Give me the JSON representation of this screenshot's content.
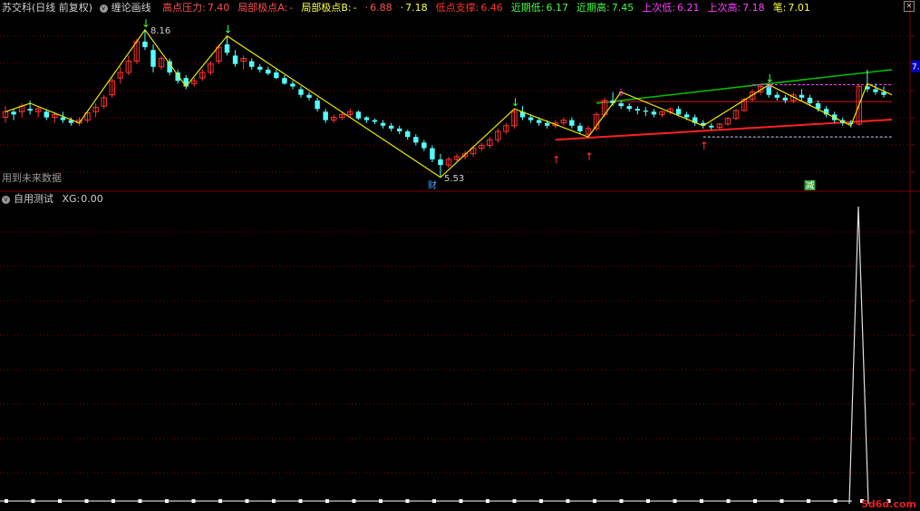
{
  "header": {
    "stock_name": "苏交科(日线 前复权)",
    "indicator_name": "缠论画线",
    "items": [
      {
        "label": "高点压力:",
        "value": "7.40",
        "color": "#ff5050"
      },
      {
        "label": "局部极点A:",
        "value": "-",
        "color": "#ff5050"
      },
      {
        "label": "局部极点B:",
        "value": "-",
        "color": "#ffff40"
      },
      {
        "label": "·",
        "value": "6.88",
        "color": "#ff5050"
      },
      {
        "label": "·",
        "value": "7.18",
        "color": "#ffff40"
      },
      {
        "label": "低点支撑:",
        "value": "6.46",
        "color": "#ff3030"
      },
      {
        "label": "近期低:",
        "value": "6.17",
        "color": "#40ff40"
      },
      {
        "label": "近期高:",
        "value": "7.45",
        "color": "#40ff40"
      },
      {
        "label": "上次低:",
        "value": "6.21",
        "color": "#ff40ff"
      },
      {
        "label": "上次高:",
        "value": "7.18",
        "color": "#ff40ff"
      },
      {
        "label": "笔:",
        "value": "7.01",
        "color": "#ffff40"
      }
    ]
  },
  "chart_annotations": {
    "high_label": "8.16",
    "low_label": "5.53",
    "future_data_note": "用到未来数据",
    "price_tag": "7.5",
    "marker_cai": "财",
    "marker_jian": "减"
  },
  "sub_panel": {
    "title": "自用测试",
    "xg_label": "XG:",
    "xg_value": "0.00"
  },
  "watermark": "5d6d.com",
  "colors": {
    "up": "#ff3232",
    "down": "#54ffff",
    "bi_line": "#e8e800",
    "upper_trend": "#00c000",
    "lower_trend": "#ff2020",
    "grid": "#800000",
    "pivot": "#ff40ff"
  },
  "chart_data": {
    "type": "candlestick",
    "ylim": [
      5.3,
      8.4
    ],
    "candles": [
      [
        6.6,
        6.8,
        6.5,
        6.7
      ],
      [
        6.7,
        6.75,
        6.55,
        6.65
      ],
      [
        6.7,
        6.85,
        6.6,
        6.8
      ],
      [
        6.75,
        6.9,
        6.65,
        6.72
      ],
      [
        6.7,
        6.8,
        6.6,
        6.75
      ],
      [
        6.7,
        6.75,
        6.55,
        6.6
      ],
      [
        6.6,
        6.7,
        6.5,
        6.65
      ],
      [
        6.6,
        6.7,
        6.5,
        6.55
      ],
      [
        6.55,
        6.6,
        6.45,
        6.5
      ],
      [
        6.5,
        6.6,
        6.45,
        6.55
      ],
      [
        6.55,
        6.7,
        6.5,
        6.68
      ],
      [
        6.7,
        6.85,
        6.6,
        6.78
      ],
      [
        6.8,
        7.0,
        6.75,
        6.95
      ],
      [
        7.0,
        7.3,
        6.95,
        7.25
      ],
      [
        7.3,
        7.5,
        7.2,
        7.4
      ],
      [
        7.4,
        7.7,
        7.35,
        7.6
      ],
      [
        7.6,
        8.0,
        7.55,
        7.95
      ],
      [
        7.95,
        8.16,
        7.8,
        7.85
      ],
      [
        7.8,
        7.9,
        7.4,
        7.5
      ],
      [
        7.5,
        7.7,
        7.45,
        7.65
      ],
      [
        7.6,
        7.65,
        7.35,
        7.4
      ],
      [
        7.4,
        7.45,
        7.2,
        7.25
      ],
      [
        7.3,
        7.35,
        7.1,
        7.15
      ],
      [
        7.2,
        7.3,
        7.15,
        7.25
      ],
      [
        7.3,
        7.45,
        7.25,
        7.4
      ],
      [
        7.4,
        7.6,
        7.35,
        7.55
      ],
      [
        7.6,
        7.9,
        7.55,
        7.85
      ],
      [
        7.9,
        8.05,
        7.7,
        7.75
      ],
      [
        7.7,
        7.8,
        7.5,
        7.55
      ],
      [
        7.6,
        7.7,
        7.45,
        7.65
      ],
      [
        7.6,
        7.65,
        7.45,
        7.5
      ],
      [
        7.5,
        7.55,
        7.4,
        7.45
      ],
      [
        7.45,
        7.5,
        7.35,
        7.38
      ],
      [
        7.4,
        7.45,
        7.28,
        7.3
      ],
      [
        7.3,
        7.35,
        7.18,
        7.2
      ],
      [
        7.2,
        7.25,
        7.1,
        7.15
      ],
      [
        7.1,
        7.15,
        6.95,
        7.0
      ],
      [
        7.0,
        7.05,
        6.9,
        6.95
      ],
      [
        6.9,
        6.95,
        6.7,
        6.75
      ],
      [
        6.7,
        6.75,
        6.5,
        6.55
      ],
      [
        6.55,
        6.65,
        6.5,
        6.6
      ],
      [
        6.6,
        6.7,
        6.55,
        6.65
      ],
      [
        6.65,
        6.75,
        6.6,
        6.7
      ],
      [
        6.7,
        6.72,
        6.55,
        6.58
      ],
      [
        6.6,
        6.62,
        6.5,
        6.55
      ],
      [
        6.55,
        6.58,
        6.48,
        6.52
      ],
      [
        6.5,
        6.55,
        6.4,
        6.45
      ],
      [
        6.45,
        6.5,
        6.35,
        6.4
      ],
      [
        6.4,
        6.45,
        6.3,
        6.35
      ],
      [
        6.35,
        6.38,
        6.2,
        6.25
      ],
      [
        6.25,
        6.3,
        6.1,
        6.15
      ],
      [
        6.15,
        6.2,
        6.0,
        6.05
      ],
      [
        6.05,
        6.1,
        5.8,
        5.85
      ],
      [
        5.85,
        5.95,
        5.53,
        5.75
      ],
      [
        5.75,
        5.9,
        5.7,
        5.85
      ],
      [
        5.85,
        5.95,
        5.8,
        5.9
      ],
      [
        5.9,
        6.0,
        5.85,
        5.95
      ],
      [
        5.95,
        6.1,
        5.9,
        6.05
      ],
      [
        6.05,
        6.15,
        6.0,
        6.1
      ],
      [
        6.1,
        6.25,
        6.05,
        6.2
      ],
      [
        6.2,
        6.4,
        6.15,
        6.35
      ],
      [
        6.35,
        6.5,
        6.3,
        6.45
      ],
      [
        6.45,
        6.75,
        6.4,
        6.7
      ],
      [
        6.7,
        6.8,
        6.55,
        6.6
      ],
      [
        6.6,
        6.65,
        6.5,
        6.55
      ],
      [
        6.55,
        6.6,
        6.45,
        6.5
      ],
      [
        6.5,
        6.55,
        6.4,
        6.45
      ],
      [
        6.45,
        6.55,
        6.4,
        6.5
      ],
      [
        6.5,
        6.6,
        6.45,
        6.55
      ],
      [
        6.55,
        6.6,
        6.4,
        6.45
      ],
      [
        6.45,
        6.5,
        6.3,
        6.35
      ],
      [
        6.3,
        6.45,
        6.25,
        6.4
      ],
      [
        6.4,
        6.7,
        6.35,
        6.65
      ],
      [
        6.65,
        6.95,
        6.6,
        6.9
      ],
      [
        6.9,
        7.05,
        6.8,
        6.85
      ],
      [
        6.85,
        6.9,
        6.75,
        6.8
      ],
      [
        6.8,
        6.85,
        6.7,
        6.75
      ],
      [
        6.75,
        6.8,
        6.65,
        6.72
      ],
      [
        6.72,
        6.78,
        6.62,
        6.7
      ],
      [
        6.7,
        6.75,
        6.6,
        6.65
      ],
      [
        6.65,
        6.72,
        6.6,
        6.7
      ],
      [
        6.7,
        6.78,
        6.65,
        6.75
      ],
      [
        6.75,
        6.8,
        6.62,
        6.65
      ],
      [
        6.65,
        6.7,
        6.55,
        6.6
      ],
      [
        6.6,
        6.65,
        6.45,
        6.5
      ],
      [
        6.5,
        6.55,
        6.4,
        6.45
      ],
      [
        6.45,
        6.5,
        6.38,
        6.42
      ],
      [
        6.42,
        6.5,
        6.38,
        6.48
      ],
      [
        6.48,
        6.6,
        6.45,
        6.58
      ],
      [
        6.58,
        6.75,
        6.55,
        6.72
      ],
      [
        6.72,
        6.95,
        6.7,
        6.92
      ],
      [
        6.92,
        7.1,
        6.88,
        7.05
      ],
      [
        7.05,
        7.2,
        7.0,
        7.15
      ],
      [
        7.15,
        7.18,
        6.95,
        7.0
      ],
      [
        7.0,
        7.05,
        6.9,
        6.95
      ],
      [
        6.95,
        7.0,
        6.85,
        6.9
      ],
      [
        6.9,
        7.05,
        6.85,
        7.0
      ],
      [
        7.0,
        7.1,
        6.9,
        6.95
      ],
      [
        6.95,
        7.0,
        6.8,
        6.85
      ],
      [
        6.85,
        6.9,
        6.7,
        6.75
      ],
      [
        6.75,
        6.8,
        6.6,
        6.65
      ],
      [
        6.65,
        6.7,
        6.5,
        6.55
      ],
      [
        6.55,
        6.6,
        6.45,
        6.5
      ],
      [
        6.5,
        6.55,
        6.42,
        6.48
      ],
      [
        6.48,
        7.2,
        6.45,
        7.15
      ],
      [
        7.15,
        7.45,
        7.05,
        7.1
      ],
      [
        7.1,
        7.2,
        7.0,
        7.05
      ],
      [
        7.05,
        7.15,
        6.95,
        7.0
      ]
    ]
  }
}
